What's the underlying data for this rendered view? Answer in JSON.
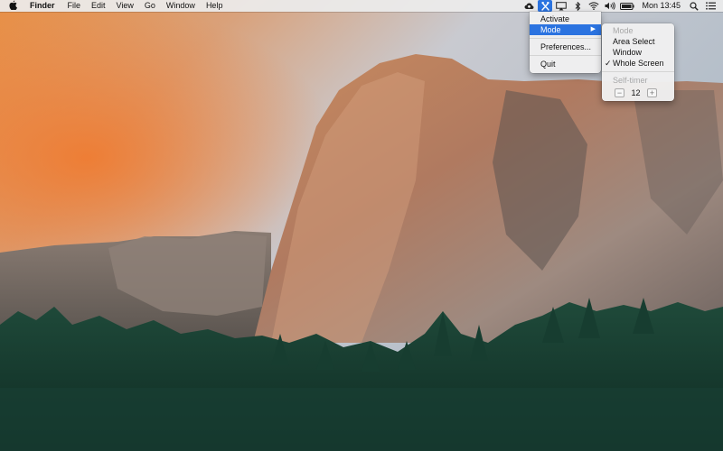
{
  "menubar": {
    "apple_icon": "apple-logo",
    "app_name": "Finder",
    "menus": [
      "File",
      "Edit",
      "View",
      "Go",
      "Window",
      "Help"
    ],
    "status_icons": [
      "creative-cloud-icon",
      "app-status-icon",
      "airplay-icon",
      "bluetooth-icon",
      "wifi-icon",
      "volume-icon",
      "battery-icon"
    ],
    "clock": "Mon 13:45",
    "right_icons": [
      "spotlight-search-icon",
      "notification-center-icon"
    ]
  },
  "dropdown": {
    "items": {
      "activate": "Activate",
      "mode": "Mode",
      "preferences": "Preferences...",
      "quit": "Quit"
    },
    "submenu_arrow": "▶"
  },
  "submenu": {
    "mode_header": "Mode",
    "area_select": "Area Select",
    "window": "Window",
    "whole_screen": "Whole Screen",
    "checked": "✓",
    "self_timer_header": "Self-timer",
    "timer_value": "12",
    "minus": "−",
    "plus": "+"
  },
  "colors": {
    "accent": "#2b73e0",
    "menubar_bg": "#ececec"
  }
}
